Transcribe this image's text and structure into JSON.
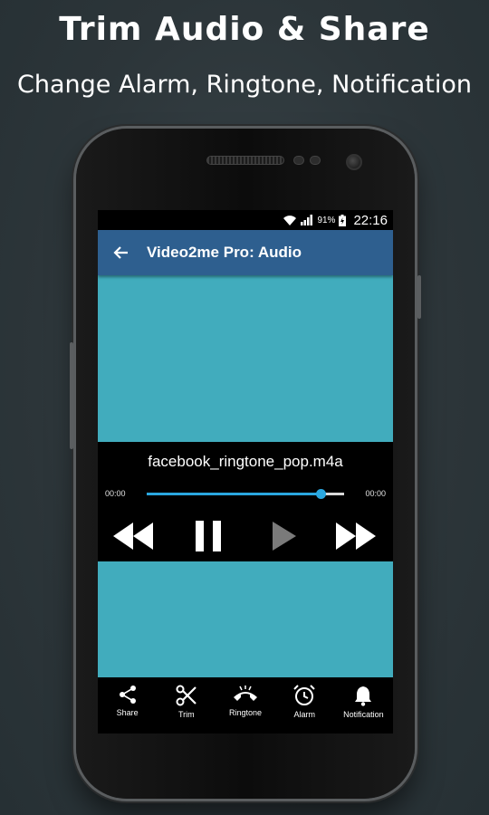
{
  "promo": {
    "title": "Trim Audio & Share",
    "subtitle": "Change Alarm, Ringtone, Notification"
  },
  "status_bar": {
    "battery": "91%",
    "time": "22:16",
    "icons": [
      "wifi-icon",
      "signal-icon",
      "battery-icon"
    ]
  },
  "app_bar": {
    "back_icon": "arrow-left-icon",
    "title": "Video2me Pro: Audio"
  },
  "player": {
    "filename": "facebook_ringtone_pop.m4a",
    "time_left": "00:00",
    "time_right": "00:00",
    "progress": 0.88,
    "controls": [
      "rewind-icon",
      "pause-icon",
      "play-icon",
      "fast-forward-icon"
    ]
  },
  "bottom_nav": {
    "items": [
      {
        "label": "Share",
        "icon": "share-icon"
      },
      {
        "label": "Trim",
        "icon": "scissors-icon"
      },
      {
        "label": "Ringtone",
        "icon": "phone-icon"
      },
      {
        "label": "Alarm",
        "icon": "alarm-clock-icon"
      },
      {
        "label": "Notification",
        "icon": "bell-icon"
      }
    ]
  },
  "colors": {
    "app_bar": "#2e5f8f",
    "artwork": "#41acbd",
    "accent": "#2aa7df",
    "background": "#2c3539"
  }
}
